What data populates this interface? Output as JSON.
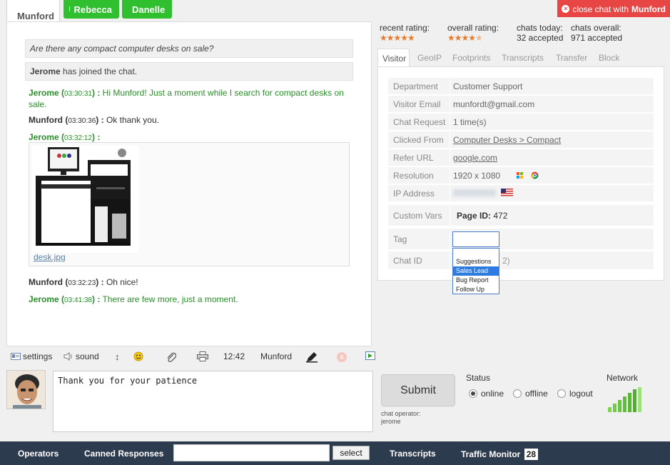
{
  "tabs": [
    {
      "label": "Munford",
      "active": true
    },
    {
      "label": "Rebecca",
      "active": false
    },
    {
      "label": "Danelle",
      "active": false
    }
  ],
  "close_chat": {
    "prefix": "close chat with",
    "name": "Munford"
  },
  "chat": {
    "question": "Are there any compact computer desks on sale?",
    "joined_name": "Jerome",
    "joined_text": "has joined the chat.",
    "messages": [
      {
        "name": "Jerome",
        "time": "03:30:31",
        "text": "Hi Munford! Just a moment while I search for compact desks on sale.",
        "role": "operator"
      },
      {
        "name": "Munford",
        "time": "03:30:36",
        "text": "Ok thank you.",
        "role": "visitor"
      },
      {
        "name": "Jerome",
        "time": "03:32:12",
        "text": "",
        "role": "operator"
      },
      {
        "name": "Munford",
        "time": "03:32:23",
        "text": "Oh nice!",
        "role": "visitor"
      },
      {
        "name": "Jerome",
        "time": "03:41:38",
        "text": "There are few more, just a moment.",
        "role": "operator"
      }
    ],
    "file_name": "desk.jpg"
  },
  "toolbar": {
    "settings": "settings",
    "sound": "sound",
    "time": "12:42",
    "visitor": "Munford"
  },
  "composer": {
    "text": "Thank you for your patience",
    "submit": "Submit",
    "operator_label": "chat operator:",
    "operator_name": "jerome"
  },
  "status": {
    "label": "Status",
    "options": [
      "online",
      "offline",
      "logout"
    ],
    "selected": "online"
  },
  "network_label": "Network",
  "stats": {
    "recent_label": "recent rating:",
    "recent_stars": 5,
    "overall_label": "overall rating:",
    "overall_stars": 4,
    "today_label": "chats today:",
    "today_value": "32 accepted",
    "overall_chats_label": "chats overall:",
    "overall_chats_value": "971 accepted"
  },
  "visitor_tabs": [
    "Visitor",
    "GeoIP",
    "Footprints",
    "Transcripts",
    "Transfer",
    "Block"
  ],
  "visitor_info": {
    "department_label": "Department",
    "department": "Customer Support",
    "email_label": "Visitor Email",
    "email": "munfordt@gmail.com",
    "request_label": "Chat Request",
    "request": "1 time(s)",
    "clicked_label": "Clicked From",
    "clicked": "Computer Desks > Compact",
    "refer_label": "Refer URL",
    "refer": "google.com",
    "resolution_label": "Resolution",
    "resolution": "1920 x 1080",
    "ip_label": "IP Address",
    "vars_label": "Custom Vars",
    "vars_key": "Page ID:",
    "vars_value": "472",
    "tag_label": "Tag",
    "chatid_label": "Chat ID",
    "chatid_partial": "2)"
  },
  "tag_options": [
    "Suggestions",
    "Sales Lead",
    "Bug Report",
    "Follow Up"
  ],
  "tag_selected": "Sales Lead",
  "bottom": {
    "operators": "Operators",
    "canned": "Canned Responses",
    "select": "select",
    "transcripts": "Transcripts",
    "traffic": "Traffic Monitor",
    "traffic_count": "28"
  }
}
